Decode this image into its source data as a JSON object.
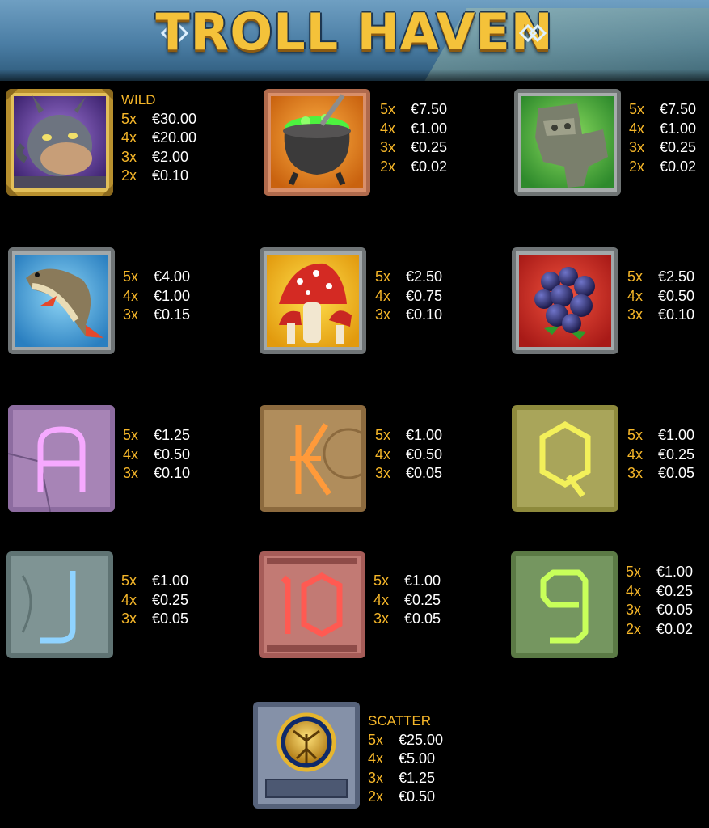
{
  "header": {
    "title": "TROLL HAVEN"
  },
  "symbols": [
    {
      "id": "troll",
      "icon": "troll-wild-icon",
      "label": "WILD",
      "pays": [
        {
          "m": "5x",
          "v": "€30.00"
        },
        {
          "m": "4x",
          "v": "€20.00"
        },
        {
          "m": "3x",
          "v": "€2.00"
        },
        {
          "m": "2x",
          "v": "€0.10"
        }
      ]
    },
    {
      "id": "cauldron",
      "icon": "cauldron-icon",
      "label": "",
      "pays": [
        {
          "m": "5x",
          "v": "€7.50"
        },
        {
          "m": "4x",
          "v": "€1.00"
        },
        {
          "m": "3x",
          "v": "€0.25"
        },
        {
          "m": "2x",
          "v": "€0.02"
        }
      ]
    },
    {
      "id": "stone",
      "icon": "stone-totem-icon",
      "label": "",
      "pays": [
        {
          "m": "5x",
          "v": "€7.50"
        },
        {
          "m": "4x",
          "v": "€1.00"
        },
        {
          "m": "3x",
          "v": "€0.25"
        },
        {
          "m": "2x",
          "v": "€0.02"
        }
      ]
    },
    {
      "id": "fish",
      "icon": "fish-icon",
      "label": "",
      "pays": [
        {
          "m": "5x",
          "v": "€4.00"
        },
        {
          "m": "4x",
          "v": "€1.00"
        },
        {
          "m": "3x",
          "v": "€0.15"
        }
      ]
    },
    {
      "id": "mushroom",
      "icon": "mushroom-icon",
      "label": "",
      "pays": [
        {
          "m": "5x",
          "v": "€2.50"
        },
        {
          "m": "4x",
          "v": "€0.75"
        },
        {
          "m": "3x",
          "v": "€0.10"
        }
      ]
    },
    {
      "id": "berries",
      "icon": "berries-icon",
      "label": "",
      "pays": [
        {
          "m": "5x",
          "v": "€2.50"
        },
        {
          "m": "4x",
          "v": "€0.50"
        },
        {
          "m": "3x",
          "v": "€0.10"
        }
      ]
    },
    {
      "id": "a",
      "icon": "rune-a-icon",
      "label": "",
      "pays": [
        {
          "m": "5x",
          "v": "€1.25"
        },
        {
          "m": "4x",
          "v": "€0.50"
        },
        {
          "m": "3x",
          "v": "€0.10"
        }
      ]
    },
    {
      "id": "k",
      "icon": "rune-k-icon",
      "label": "",
      "pays": [
        {
          "m": "5x",
          "v": "€1.00"
        },
        {
          "m": "4x",
          "v": "€0.50"
        },
        {
          "m": "3x",
          "v": "€0.05"
        }
      ]
    },
    {
      "id": "q",
      "icon": "rune-q-icon",
      "label": "",
      "pays": [
        {
          "m": "5x",
          "v": "€1.00"
        },
        {
          "m": "4x",
          "v": "€0.25"
        },
        {
          "m": "3x",
          "v": "€0.05"
        }
      ]
    },
    {
      "id": "j",
      "icon": "rune-j-icon",
      "label": "",
      "pays": [
        {
          "m": "5x",
          "v": "€1.00"
        },
        {
          "m": "4x",
          "v": "€0.25"
        },
        {
          "m": "3x",
          "v": "€0.05"
        }
      ]
    },
    {
      "id": "ten",
      "icon": "rune-10-icon",
      "label": "",
      "pays": [
        {
          "m": "5x",
          "v": "€1.00"
        },
        {
          "m": "4x",
          "v": "€0.25"
        },
        {
          "m": "3x",
          "v": "€0.05"
        }
      ]
    },
    {
      "id": "nine",
      "icon": "rune-9-icon",
      "label": "",
      "pays": [
        {
          "m": "5x",
          "v": "€1.00"
        },
        {
          "m": "4x",
          "v": "€0.25"
        },
        {
          "m": "3x",
          "v": "€0.05"
        },
        {
          "m": "2x",
          "v": "€0.02"
        }
      ]
    },
    {
      "id": "scatter",
      "icon": "tree-scatter-icon",
      "label": "SCATTER",
      "pays": [
        {
          "m": "5x",
          "v": "€25.00"
        },
        {
          "m": "4x",
          "v": "€5.00"
        },
        {
          "m": "3x",
          "v": "€1.25"
        },
        {
          "m": "2x",
          "v": "€0.50"
        }
      ]
    }
  ]
}
